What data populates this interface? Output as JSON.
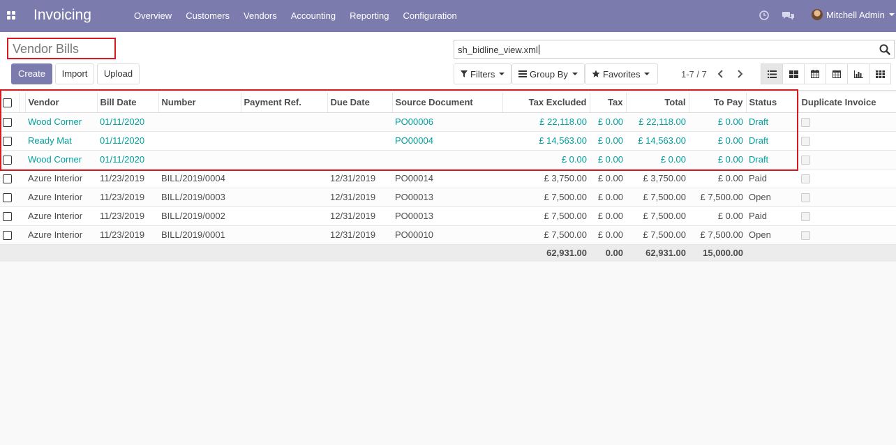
{
  "navbar": {
    "apps_icon": "apps-grid-icon",
    "brand": "Invoicing",
    "menu": [
      "Overview",
      "Customers",
      "Vendors",
      "Accounting",
      "Reporting",
      "Configuration"
    ],
    "user": "Mitchell Admin",
    "color": "#7c7bad"
  },
  "control_panel": {
    "title": "Vendor Bills",
    "buttons": {
      "create": "Create",
      "import": "Import",
      "upload": "Upload"
    },
    "search_value": "sh_bidline_view.xml",
    "filters": "Filters",
    "group_by": "Group By",
    "favorites": "Favorites",
    "pager": "1-7 / 7"
  },
  "table": {
    "columns": [
      "Vendor",
      "Bill Date",
      "Number",
      "Payment Ref.",
      "Due Date",
      "Source Document",
      "Tax Excluded",
      "Tax",
      "Total",
      "To Pay",
      "Status",
      "Duplicate Invoice"
    ],
    "rows": [
      {
        "vendor": "Wood Corner",
        "bill_date": "01/11/2020",
        "number": "",
        "payment_ref": "",
        "due_date": "",
        "source": "PO00006",
        "tax_excluded": "£ 22,118.00",
        "tax": "£ 0.00",
        "total": "£ 22,118.00",
        "to_pay": "£ 0.00",
        "status": "Draft"
      },
      {
        "vendor": "Ready Mat",
        "bill_date": "01/11/2020",
        "number": "",
        "payment_ref": "",
        "due_date": "",
        "source": "PO00004",
        "tax_excluded": "£ 14,563.00",
        "tax": "£ 0.00",
        "total": "£ 14,563.00",
        "to_pay": "£ 0.00",
        "status": "Draft"
      },
      {
        "vendor": "Wood Corner",
        "bill_date": "01/11/2020",
        "number": "",
        "payment_ref": "",
        "due_date": "",
        "source": "",
        "tax_excluded": "£ 0.00",
        "tax": "£ 0.00",
        "total": "£ 0.00",
        "to_pay": "£ 0.00",
        "status": "Draft"
      },
      {
        "vendor": "Azure Interior",
        "bill_date": "11/23/2019",
        "number": "BILL/2019/0004",
        "payment_ref": "",
        "due_date": "12/31/2019",
        "source": "PO00014",
        "tax_excluded": "£ 3,750.00",
        "tax": "£ 0.00",
        "total": "£ 3,750.00",
        "to_pay": "£ 0.00",
        "status": "Paid"
      },
      {
        "vendor": "Azure Interior",
        "bill_date": "11/23/2019",
        "number": "BILL/2019/0003",
        "payment_ref": "",
        "due_date": "12/31/2019",
        "source": "PO00013",
        "tax_excluded": "£ 7,500.00",
        "tax": "£ 0.00",
        "total": "£ 7,500.00",
        "to_pay": "£ 7,500.00",
        "status": "Open"
      },
      {
        "vendor": "Azure Interior",
        "bill_date": "11/23/2019",
        "number": "BILL/2019/0002",
        "payment_ref": "",
        "due_date": "12/31/2019",
        "source": "PO00013",
        "tax_excluded": "£ 7,500.00",
        "tax": "£ 0.00",
        "total": "£ 7,500.00",
        "to_pay": "£ 0.00",
        "status": "Paid"
      },
      {
        "vendor": "Azure Interior",
        "bill_date": "11/23/2019",
        "number": "BILL/2019/0001",
        "payment_ref": "",
        "due_date": "12/31/2019",
        "source": "PO00010",
        "tax_excluded": "£ 7,500.00",
        "tax": "£ 0.00",
        "total": "£ 7,500.00",
        "to_pay": "£ 7,500.00",
        "status": "Open"
      }
    ],
    "totals": {
      "tax_excluded": "62,931.00",
      "tax": "0.00",
      "total": "62,931.00",
      "to_pay": "15,000.00"
    }
  },
  "colors": {
    "accent": "#7c7bad",
    "link": "#00a09d",
    "highlight": "#d71920"
  }
}
